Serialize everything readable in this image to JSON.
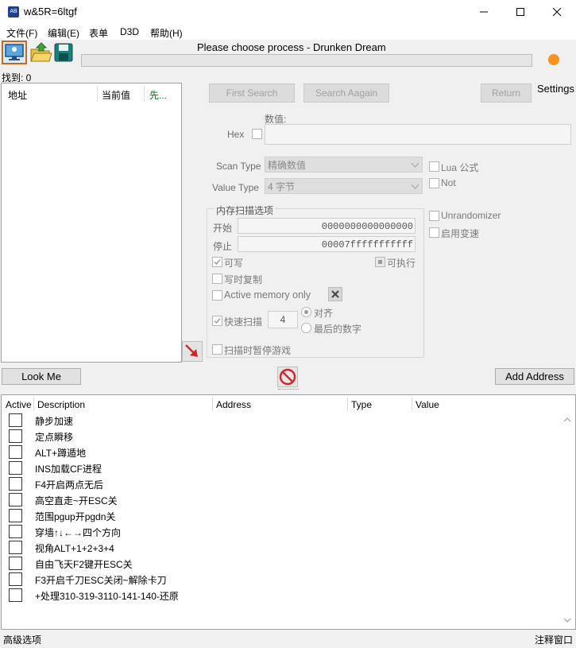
{
  "window": {
    "title": "w&5R=6ltgf",
    "app_icon_text": "AB"
  },
  "menu": [
    "文件(F)",
    "编辑(E)",
    "表单",
    "D3D",
    "帮助(H)"
  ],
  "process_title": "Please choose process - Drunken Dream",
  "found_label": "找到: 0",
  "results_columns": [
    "地址",
    "当前值",
    "先..."
  ],
  "buttons": {
    "first_search": "First Search",
    "search_again": "Search Aagain",
    "return": "Return",
    "settings": "Settings",
    "look_me": "Look Me",
    "add_address": "Add Address"
  },
  "scan": {
    "value_label": "数值:",
    "hex_label": "Hex",
    "scan_type_label": "Scan Type",
    "scan_type_value": "精确数值",
    "value_type_label": "Value Type",
    "value_type_value": "4 字节",
    "lua_label": "Lua 公式",
    "not_label": "Not",
    "memory_group_title": "内存扫描选项",
    "start_label": "开始",
    "start_value": "0000000000000000",
    "stop_label": "停止",
    "stop_value": "00007fffffffffff",
    "writable_label": "可写",
    "executable_label": "可执行",
    "cow_label": "写时复制",
    "active_memory_label": "Active memory only",
    "fast_scan_label": "快速扫描",
    "fast_scan_value": "4",
    "align_label": "对齐",
    "last_digits_label": "最后的数字",
    "pause_label": "扫描时暂停游戏",
    "unrandomizer_label": "Unrandomizer",
    "speedhack_label": "启用变速"
  },
  "address_list": {
    "columns": [
      "Active",
      "Description",
      "Address",
      "Type",
      "Value"
    ],
    "rows": [
      "静步加速",
      "定点瞬移",
      "ALT+蹲遁地",
      "INS加载CF进程",
      "F4开启两点无后",
      "高空直走~开ESC关",
      "范围pgup开pgdn关",
      "穿墙↑↓←→四个方向",
      "视角ALT+1+2+3+4",
      "自由飞天F2键开ESC关",
      "F3开启千刀ESC关闭~解除卡刀",
      "+处理310-319-3110-141-140-还原"
    ]
  },
  "statusbar": {
    "left": "高级选项",
    "right": "注释窗口"
  },
  "colors": {
    "accent_orange": "#f7931e",
    "stop_red": "#d4232a",
    "found_green": "#008000"
  }
}
